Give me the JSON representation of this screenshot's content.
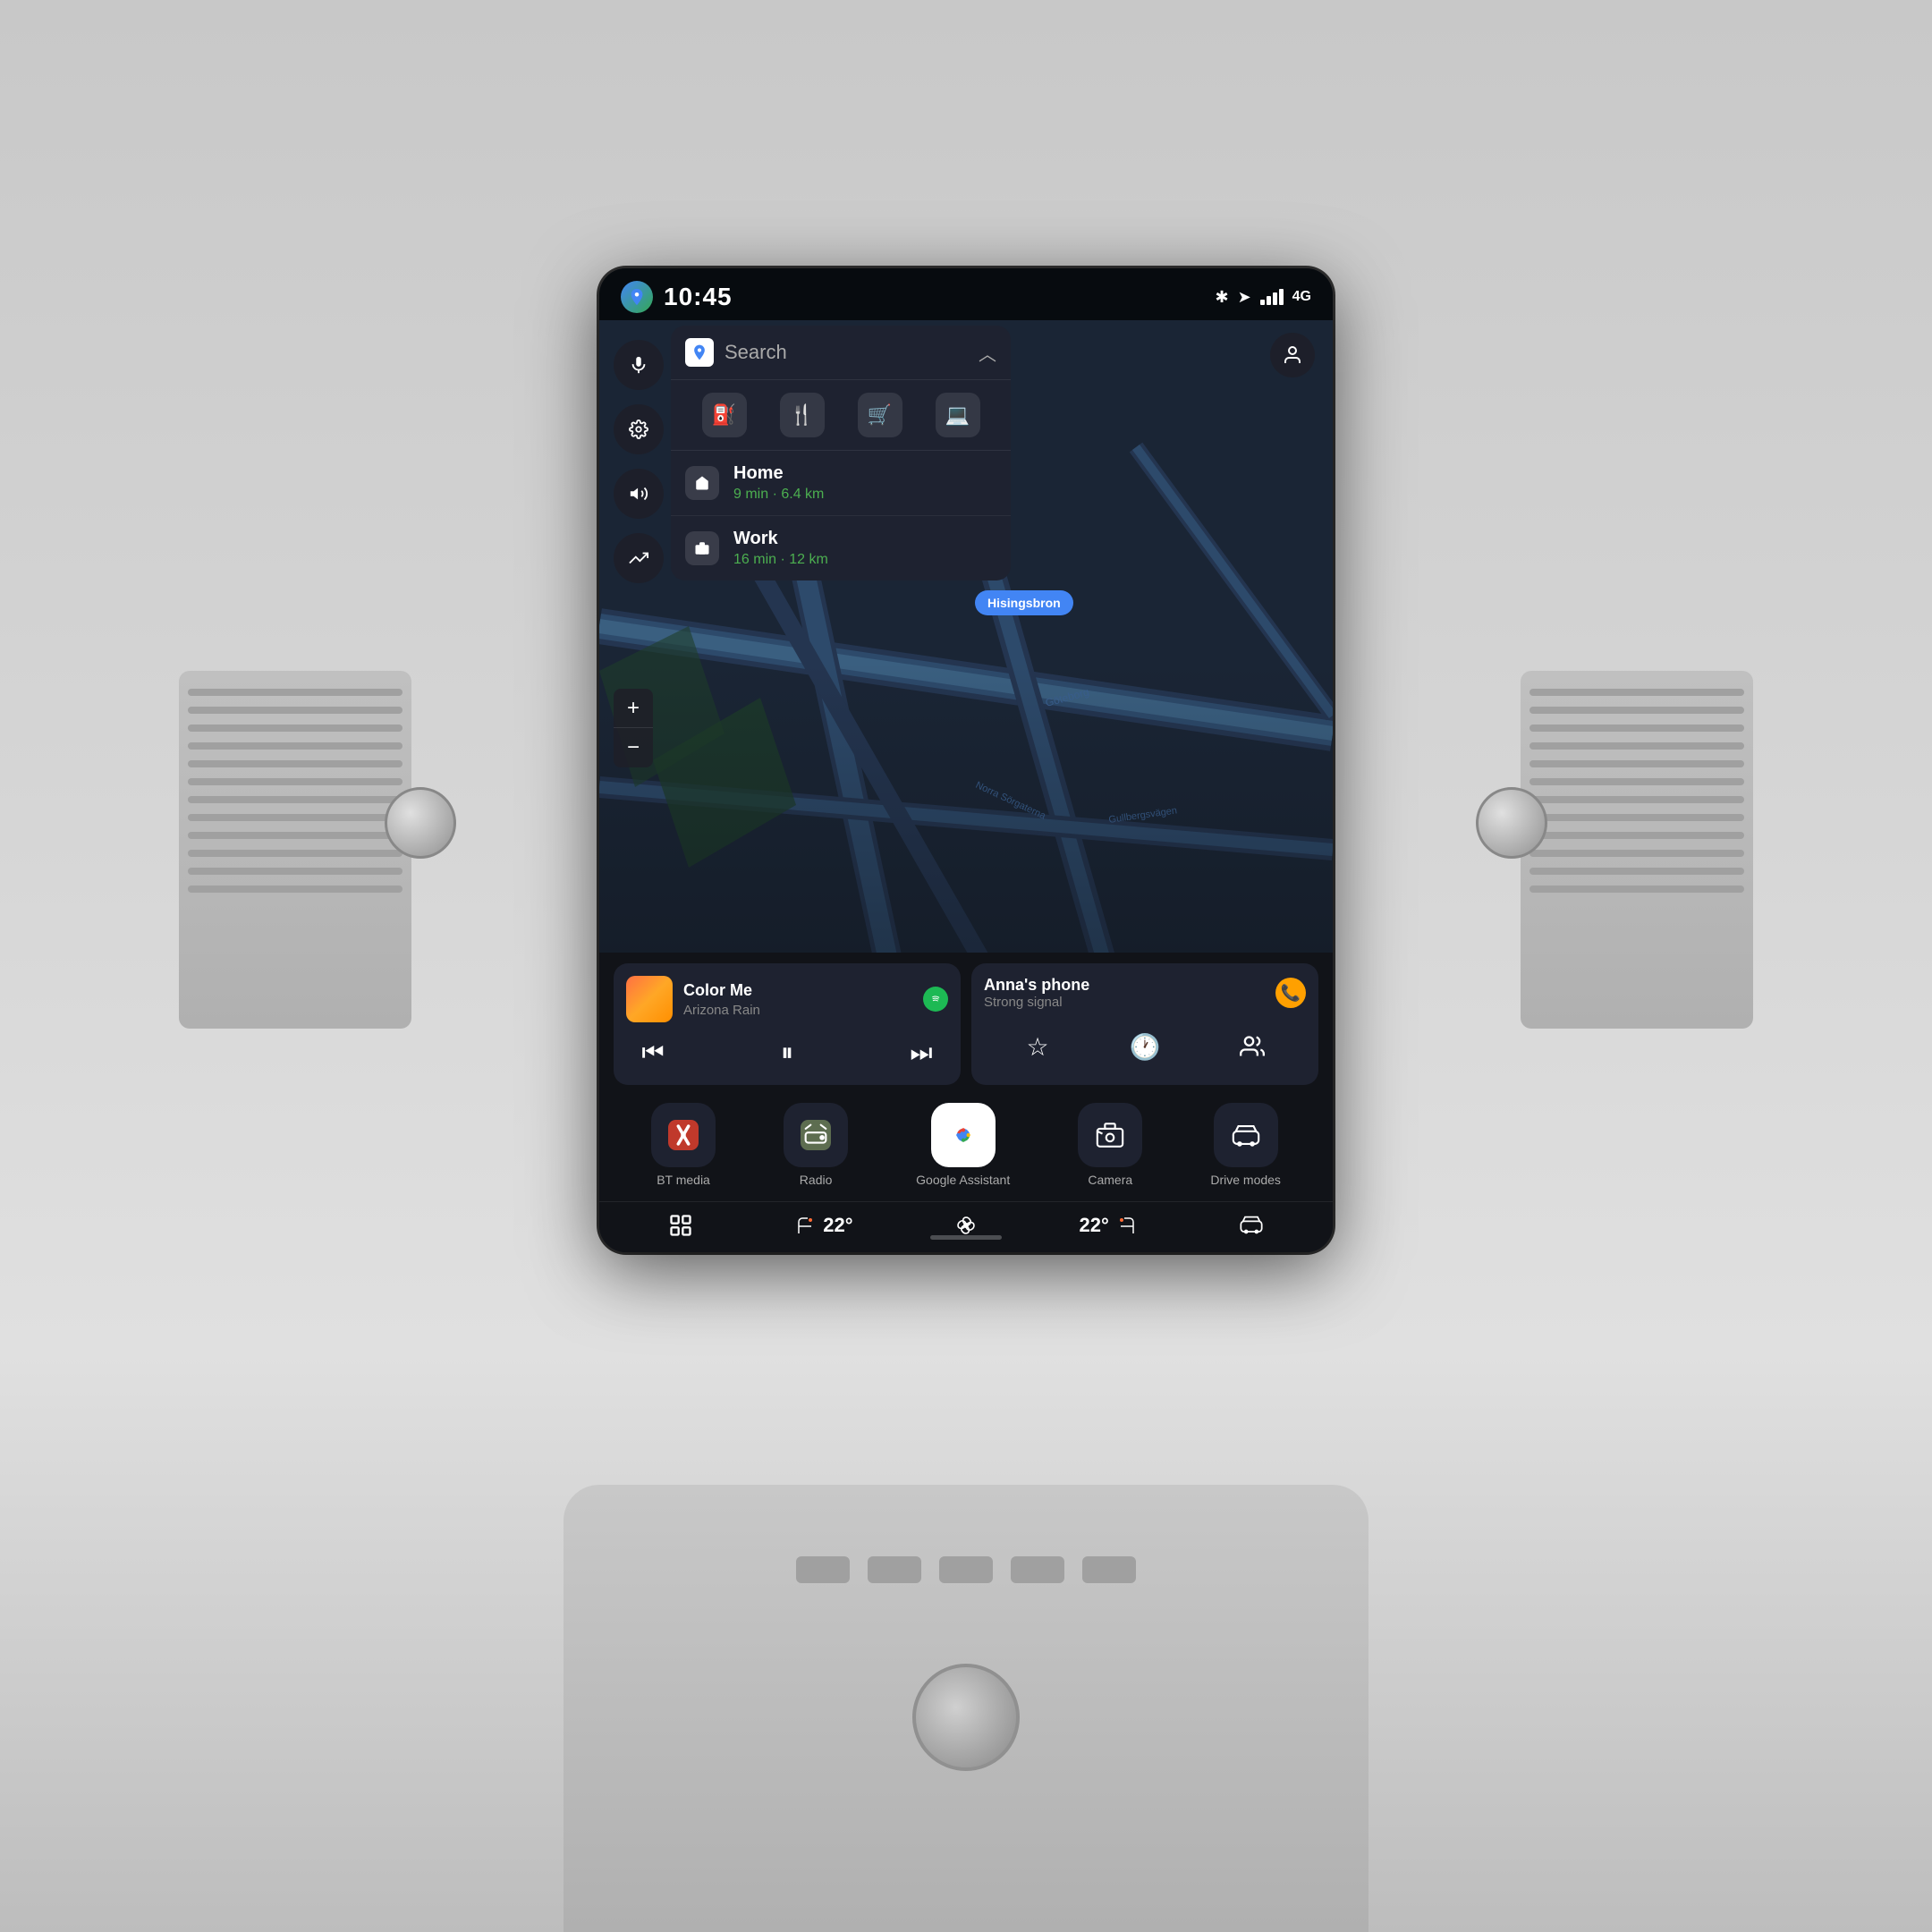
{
  "car": {
    "background_color": "#d4d4d4"
  },
  "screen": {
    "time": "10:45",
    "network": "4G",
    "profile_icon": "👤"
  },
  "search_panel": {
    "search_label": "Search",
    "maps_icon": "maps",
    "categories": [
      {
        "icon": "⛽",
        "label": "Gas"
      },
      {
        "icon": "🍴",
        "label": "Food"
      },
      {
        "icon": "🛒",
        "label": "Shopping"
      },
      {
        "icon": "💻",
        "label": "Services"
      }
    ],
    "destinations": [
      {
        "icon": "🏠",
        "name": "Home",
        "detail": "9 min · 6.4 km"
      },
      {
        "icon": "💼",
        "name": "Work",
        "detail": "16 min · 12 km"
      }
    ]
  },
  "sidebar": {
    "icons": [
      "🎤",
      "⚙️",
      "🔊",
      "↕️"
    ]
  },
  "map": {
    "pin_label": "Hisingsbron",
    "zoom_plus": "+",
    "zoom_minus": "−"
  },
  "media_card": {
    "title": "Color Me",
    "artist": "Arizona Rain",
    "service": "Spotify"
  },
  "phone_card": {
    "name": "Anna's phone",
    "signal": "Strong signal"
  },
  "dock": [
    {
      "label": "BT media",
      "icon": "📡"
    },
    {
      "label": "Radio",
      "icon": "📻"
    },
    {
      "label": "Google Assistant",
      "icon": "🎤"
    },
    {
      "label": "Camera",
      "icon": "📷"
    },
    {
      "label": "Drive modes",
      "icon": "🚗"
    }
  ],
  "climate_bar": {
    "left_temp": "22°",
    "right_temp": "22°",
    "seat_icon": "🪑",
    "fan_icon": "❄️",
    "car_icon": "🚗"
  }
}
